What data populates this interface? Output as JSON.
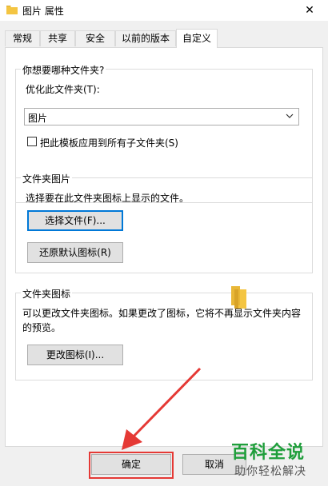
{
  "window": {
    "title": "图片 属性",
    "close_symbol": "✕"
  },
  "tabs": [
    {
      "label": "常规",
      "active": false
    },
    {
      "label": "共享",
      "active": false
    },
    {
      "label": "安全",
      "active": false
    },
    {
      "label": "以前的版本",
      "active": false
    },
    {
      "label": "自定义",
      "active": true
    }
  ],
  "optimize_group": {
    "heading": "你想要哪种文件夹?",
    "label": "优化此文件夹(T):",
    "selected": "图片",
    "checkbox_label": "把此模板应用到所有子文件夹(S)",
    "checkbox_checked": false
  },
  "folder_picture_group": {
    "heading": "文件夹图片",
    "description": "选择要在此文件夹图标上显示的文件。",
    "choose_button": "选择文件(F)...",
    "restore_button": "还原默认图标(R)"
  },
  "folder_icon_group": {
    "heading": "文件夹图标",
    "description_line1": "可以更改文件夹图标。如果更改了图标，它将不再显示文件夹内容",
    "description_line2": "的预览。",
    "change_button": "更改图标(I)..."
  },
  "footer": {
    "ok_button": "确定",
    "cancel_button": "取消"
  },
  "watermark": {
    "big": "百科全说",
    "small": "助你轻松解决"
  },
  "colors": {
    "annotation": "#e53935",
    "focus": "#0078d7",
    "folder": "#f4c542",
    "watermark": "#1f9e3b"
  },
  "icons": {
    "title": "folder-icon",
    "close": "close-icon",
    "dropdown": "chevron-down-icon",
    "preview": "folder-icon"
  }
}
